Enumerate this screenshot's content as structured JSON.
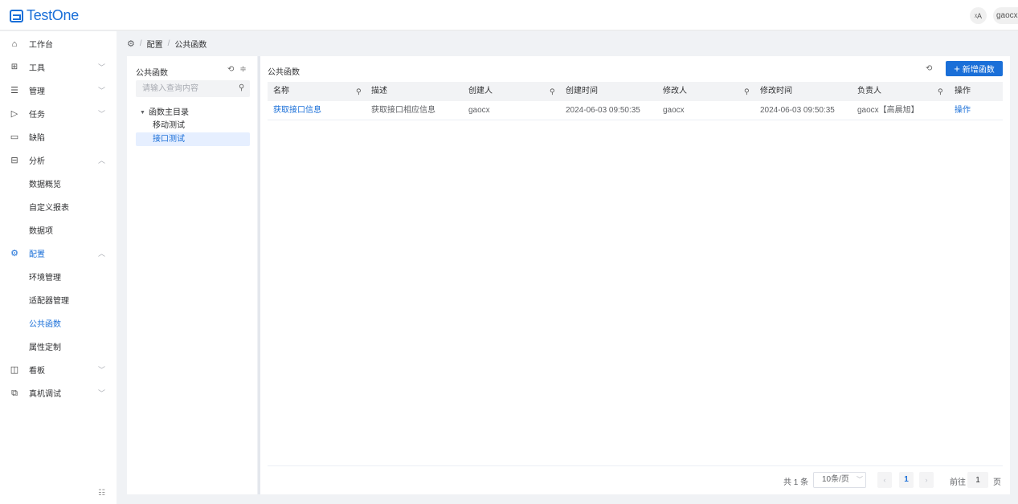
{
  "app": {
    "title": "TestOne",
    "lang_icon": "translate-icon",
    "lang_glyph": "ᵡA",
    "user": "gaocx"
  },
  "breadcrumb": {
    "home_icon": "gear-icon",
    "items": [
      "配置",
      "公共函数"
    ]
  },
  "sidebar": {
    "items": [
      {
        "label": "工作台",
        "icon": "home-icon"
      },
      {
        "label": "工具",
        "icon": "grid-icon"
      },
      {
        "label": "管理",
        "icon": "list-icon"
      },
      {
        "label": "任务",
        "icon": "send-icon"
      },
      {
        "label": "缺陷",
        "icon": "document-icon"
      },
      {
        "label": "分析",
        "icon": "calendar-icon"
      },
      {
        "label": "数据概览"
      },
      {
        "label": "自定义报表"
      },
      {
        "label": "数据项"
      },
      {
        "label": "配置",
        "icon": "gear-icon"
      },
      {
        "label": "环境管理"
      },
      {
        "label": "适配器管理"
      },
      {
        "label": "公共函数"
      },
      {
        "label": "属性定制"
      },
      {
        "label": "看板",
        "icon": "panel-icon"
      },
      {
        "label": "真机调试",
        "icon": "device-icon"
      }
    ]
  },
  "tree": {
    "title": "公共函数",
    "search_placeholder": "请输入查询内容",
    "root": "函数主目录",
    "children": [
      "移动测试",
      "接口测试"
    ]
  },
  "main": {
    "title": "公共函数",
    "add_button": "新增函数",
    "columns": [
      "名称",
      "描述",
      "创建人",
      "创建时间",
      "修改人",
      "修改时间",
      "负责人",
      "操作"
    ],
    "rows": [
      [
        "获取接口信息",
        "获取接口相应信息",
        "gaocx",
        "2024-06-03 09:50:35",
        "gaocx",
        "2024-06-03 09:50:35",
        "gaocx【高晨旭】",
        "操作"
      ]
    ]
  },
  "pagination": {
    "total": "共 1 条",
    "page_size": "10条/页",
    "current_page": "1",
    "goto_label": "前往",
    "goto_value": "1",
    "page_unit": "页"
  },
  "colors": {
    "accent": "#1a6fd8",
    "selected_bg": "#e6efff"
  }
}
